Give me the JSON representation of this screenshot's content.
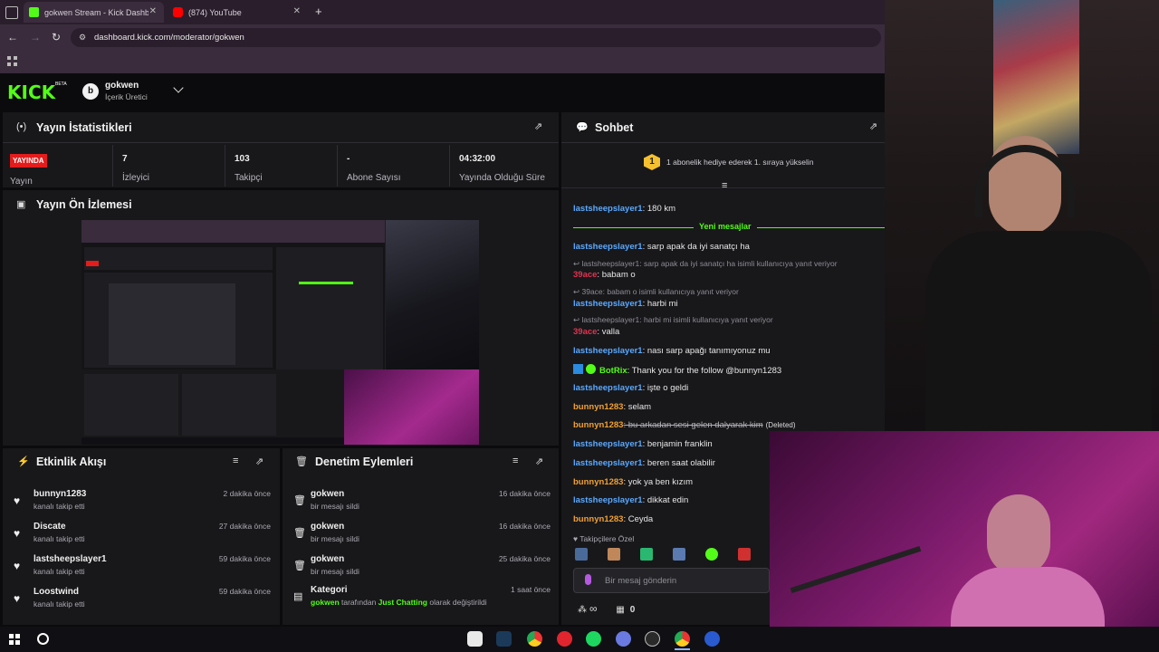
{
  "browser": {
    "tabs": [
      {
        "title": "gokwen Stream - Kick Dashboa",
        "icon": "kick-icon",
        "color": "#53fc18"
      },
      {
        "title": "(874) YouTube",
        "icon": "youtube-icon",
        "color": "#ff0000"
      }
    ],
    "url": "dashboard.kick.com/moderator/gokwen",
    "new_tab": "+",
    "close": "✕"
  },
  "header": {
    "logo": "KICK",
    "logo_badge": "BETA",
    "channel_name": "gokwen",
    "channel_role": "İçerik Üretici"
  },
  "stats": {
    "title": "Yayın İstatistikleri",
    "live_badge": "YAYINDA",
    "live_label": "Yayın",
    "viewers_value": "7",
    "viewers_label": "İzleyici",
    "followers_value": "103",
    "followers_label": "Takipçi",
    "subs_value": "-",
    "subs_label": "Abone Sayısı",
    "duration_value": "04:32:00",
    "duration_label": "Yayında Olduğu Süre"
  },
  "preview": {
    "title": "Yayın Ön İzlemesi"
  },
  "activity": {
    "title": "Etkinlik Akışı",
    "items": [
      {
        "name": "bunnyn1283",
        "action": "kanalı takip etti",
        "time": "2 dakika önce"
      },
      {
        "name": "Discate",
        "action": "kanalı takip etti",
        "time": "27 dakika önce"
      },
      {
        "name": "lastsheepslayer1",
        "action": "kanalı takip etti",
        "time": "59 dakika önce"
      },
      {
        "name": "Loostwind",
        "action": "kanalı takip etti",
        "time": "59 dakika önce"
      }
    ]
  },
  "moderation": {
    "title": "Denetim Eylemleri",
    "items": [
      {
        "name": "gokwen",
        "action": "bir mesajı sildi",
        "time": "16 dakika önce"
      },
      {
        "name": "gokwen",
        "action": "bir mesajı sildi",
        "time": "16 dakika önce"
      },
      {
        "name": "gokwen",
        "action": "bir mesajı sildi",
        "time": "25 dakika önce"
      }
    ],
    "category": {
      "name": "Kategori",
      "time": "1 saat önce",
      "user": "gokwen",
      "mid": " tarafından ",
      "value": "Just Chatting",
      "end": " olarak değiştirildi"
    }
  },
  "chat": {
    "title": "Sohbet",
    "gift_rank": "1",
    "gift_text": "1 abonelik hediye ederek 1. sıraya yükselin",
    "new_messages": "Yeni mesajlar",
    "messages": [
      {
        "user": "lastsheepslayer1",
        "text": ": 180 km",
        "cls": "u-blue"
      },
      {
        "user": "lastsheepslayer1",
        "text": ": sarp apak da iyi sanatçı ha",
        "cls": "u-blue"
      },
      {
        "reply": "lastsheepslayer1: sarp apak da iyi sanatçı ha isimli kullanıcıya yanıt veriyor"
      },
      {
        "user": "39ace",
        "text": ": babam o",
        "cls": "u-red"
      },
      {
        "reply": "39ace: babam o isimli kullanıcıya yanıt veriyor"
      },
      {
        "user": "lastsheepslayer1",
        "text": ": harbi mi",
        "cls": "u-blue"
      },
      {
        "reply": "lastsheepslayer1: harbi mi isimli kullanıcıya yanıt veriyor"
      },
      {
        "user": "39ace",
        "text": ": valla",
        "cls": "u-red"
      },
      {
        "user": "lastsheepslayer1",
        "text": ": nası sarp apağı tanımıyonuz mu",
        "cls": "u-blue"
      },
      {
        "user": "BotRix",
        "text": ": Thank you for the follow @bunnyn1283",
        "cls": "u-green"
      },
      {
        "user": "lastsheepslayer1",
        "text": ": işte o geldi",
        "cls": "u-blue"
      },
      {
        "user": "bunnyn1283",
        "text": ": selam",
        "cls": "u-orange"
      },
      {
        "user": "bunnyn1283",
        "text": ": bu arkadan sesi gelen dalyarak kim",
        "cls": "u-orange",
        "deleted": "(Deleted)"
      },
      {
        "user": "lastsheepslayer1",
        "text": ": benjamin franklin",
        "cls": "u-blue"
      },
      {
        "user": "lastsheepslayer1",
        "text": ": beren saat olabilir",
        "cls": "u-blue"
      },
      {
        "user": "bunnyn1283",
        "text": ": yok ya ben kızım",
        "cls": "u-orange"
      },
      {
        "user": "lastsheepslayer1",
        "text": ": dikkat edin",
        "cls": "u-blue"
      },
      {
        "user": "bunnyn1283",
        "text": ": Ceyda",
        "cls": "u-orange"
      }
    ],
    "followers_only": "Takipçilere Özel",
    "input_placeholder": "Bir mesaj gönderin",
    "points": "0",
    "infinity": "∞"
  }
}
